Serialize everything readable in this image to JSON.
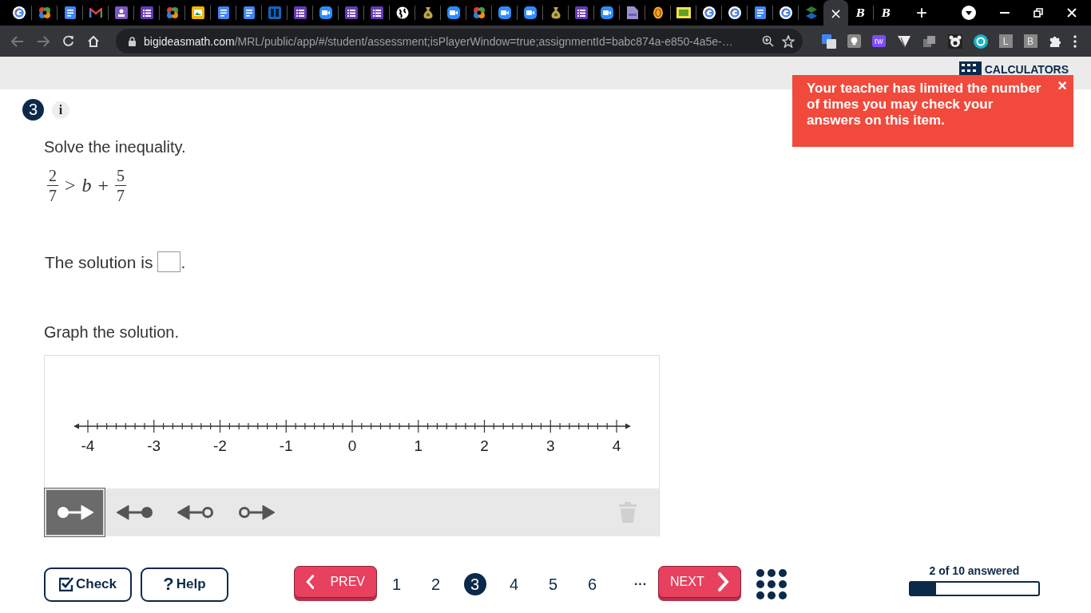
{
  "browser": {
    "tabs": [
      {
        "kind": "google",
        "selected": false
      },
      {
        "kind": "pinwheel",
        "selected": false
      },
      {
        "kind": "docs",
        "selected": false
      },
      {
        "kind": "gmail",
        "selected": false
      },
      {
        "kind": "classroom",
        "selected": false
      },
      {
        "kind": "forms",
        "selected": false
      },
      {
        "kind": "pinwheel",
        "selected": false
      },
      {
        "kind": "slides",
        "selected": false
      },
      {
        "kind": "docs",
        "selected": false
      },
      {
        "kind": "docs",
        "selected": false
      },
      {
        "kind": "board",
        "selected": false
      },
      {
        "kind": "forms",
        "selected": false
      },
      {
        "kind": "zoom",
        "selected": false
      },
      {
        "kind": "forms",
        "selected": false
      },
      {
        "kind": "forms",
        "selected": false
      },
      {
        "kind": "globe",
        "selected": false
      },
      {
        "kind": "money",
        "selected": false
      },
      {
        "kind": "zoom",
        "selected": false
      },
      {
        "kind": "pinwheel",
        "selected": false
      },
      {
        "kind": "zoom",
        "selected": false
      },
      {
        "kind": "zoom",
        "selected": false
      },
      {
        "kind": "money",
        "selected": false
      },
      {
        "kind": "forms",
        "selected": false
      },
      {
        "kind": "zoom",
        "selected": false
      },
      {
        "kind": "pdf",
        "selected": false
      },
      {
        "kind": "bitmoji",
        "selected": false
      },
      {
        "kind": "ixl",
        "selected": false
      },
      {
        "kind": "google",
        "selected": false
      },
      {
        "kind": "google",
        "selected": false
      },
      {
        "kind": "docs",
        "selected": false
      },
      {
        "kind": "google",
        "selected": false
      },
      {
        "kind": "layers",
        "selected": false
      },
      {
        "kind": "close",
        "label": "×",
        "selected": true
      },
      {
        "kind": "letter",
        "label": "B",
        "selected": false
      },
      {
        "kind": "letter",
        "label": "B",
        "selected": false
      }
    ],
    "new_tab": "+",
    "url": {
      "domain": "bigideasmath.com",
      "path": "/MRL/public/app/#/student/assessment;isPlayerWindow=true;assignmentId=babc874a-e850-4a5e-…"
    },
    "extensions": [
      {
        "kind": "translate"
      },
      {
        "kind": "bulb"
      },
      {
        "kind": "puzzle",
        "label": "rw"
      },
      {
        "kind": "flag"
      },
      {
        "kind": "copies"
      },
      {
        "kind": "bear"
      },
      {
        "kind": "ring"
      },
      {
        "kind": "letter",
        "label": "L"
      },
      {
        "kind": "letter",
        "label": "B"
      },
      {
        "kind": "extensions"
      }
    ]
  },
  "header": {
    "calculators": "CALCULATORS"
  },
  "notice": {
    "text": "Your teacher has limited the number of times you may check your answers on this item.",
    "close": "×"
  },
  "question": {
    "number": "3",
    "info": "i",
    "prompt": "Solve the inequality.",
    "equation": {
      "left": {
        "num": "2",
        "den": "7"
      },
      "relation": ">",
      "variable": "b",
      "operator": "+",
      "right": {
        "num": "5",
        "den": "7"
      }
    },
    "solution": {
      "before": "The solution is",
      "after": "."
    },
    "graph_prompt": "Graph the solution.",
    "number_line": {
      "labels": [
        "-4",
        "-3",
        "-2",
        "-1",
        "0",
        "1",
        "2",
        "3",
        "4"
      ]
    },
    "tools": [
      {
        "kind": "closed-right",
        "selected": true
      },
      {
        "kind": "closed-left",
        "selected": false
      },
      {
        "kind": "open-left",
        "selected": false
      },
      {
        "kind": "open-right",
        "selected": false
      }
    ],
    "delete_disabled": true
  },
  "footer": {
    "check": "Check",
    "help_glyph": "?",
    "help": "Help",
    "prev": "PREV",
    "next": "NEXT",
    "pages": [
      {
        "label": "1",
        "selected": false
      },
      {
        "label": "2",
        "selected": false
      },
      {
        "label": "3",
        "selected": true
      },
      {
        "label": "4",
        "selected": false
      },
      {
        "label": "5",
        "selected": false
      },
      {
        "label": "6",
        "selected": false
      }
    ],
    "more": "···",
    "progress": {
      "label": "2 of 10 answered",
      "level": 0.2
    }
  }
}
